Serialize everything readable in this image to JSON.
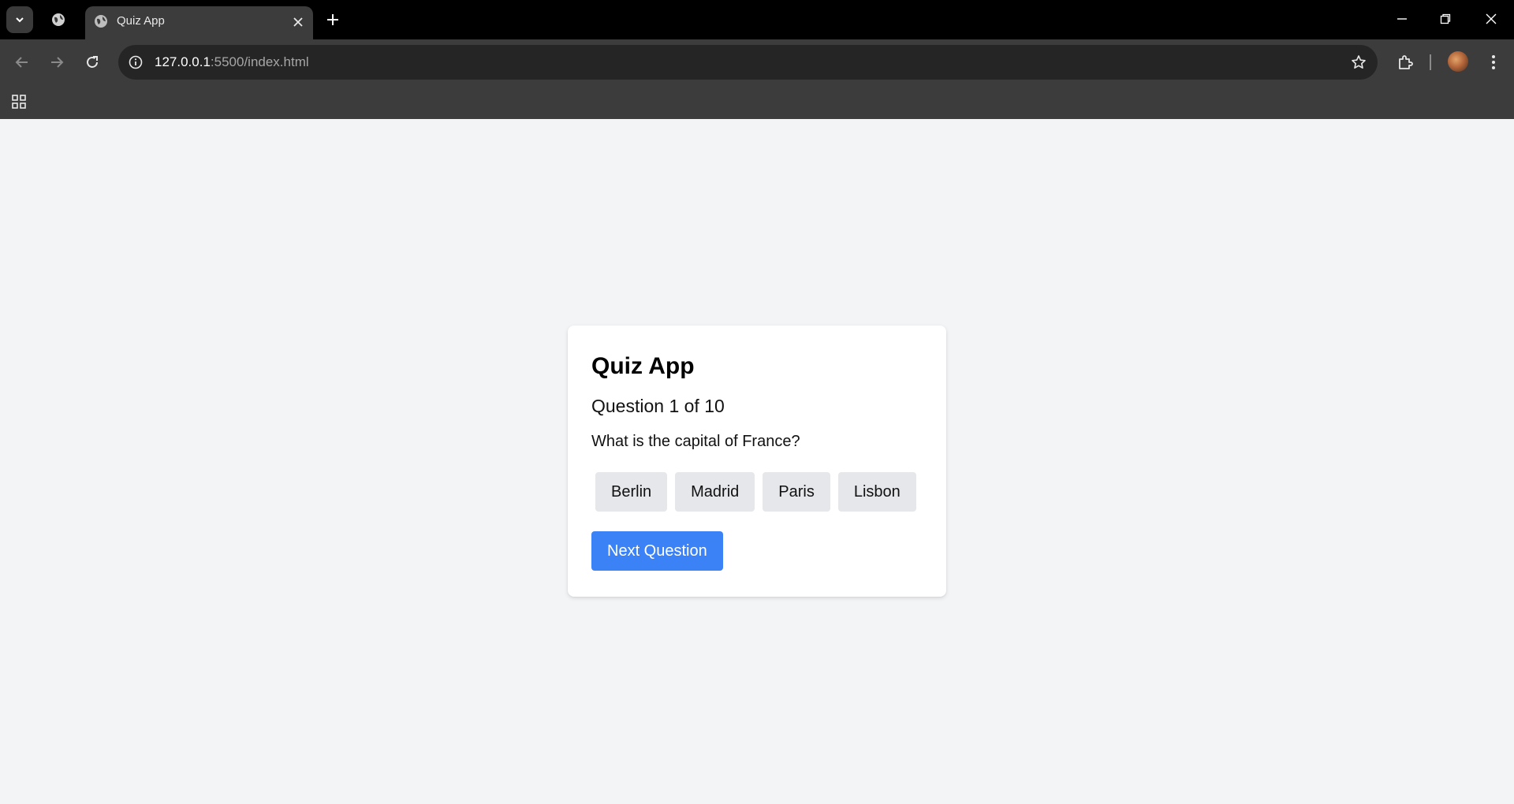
{
  "browser": {
    "tab": {
      "title": "Quiz App"
    },
    "address": {
      "host": "127.0.0.1",
      "path": ":5500/index.html"
    },
    "icons": [
      "tab-search-icon",
      "globe-icon",
      "close-icon",
      "plus-icon",
      "minimize-icon",
      "restore-icon",
      "back-arrow-icon",
      "forward-arrow-icon",
      "reload-icon",
      "info-icon",
      "star-icon",
      "extensions-icon",
      "kebab-menu-icon",
      "apps-grid-icon"
    ]
  },
  "quiz": {
    "title": "Quiz App",
    "counter": "Question 1 of 10",
    "question": "What is the capital of France?",
    "options": [
      "Berlin",
      "Madrid",
      "Paris",
      "Lisbon"
    ],
    "next_label": "Next Question"
  },
  "colors": {
    "page_bg": "#f3f4f6",
    "card_bg": "#ffffff",
    "option_bg": "#e5e7eb",
    "primary": "#3b82f6"
  }
}
